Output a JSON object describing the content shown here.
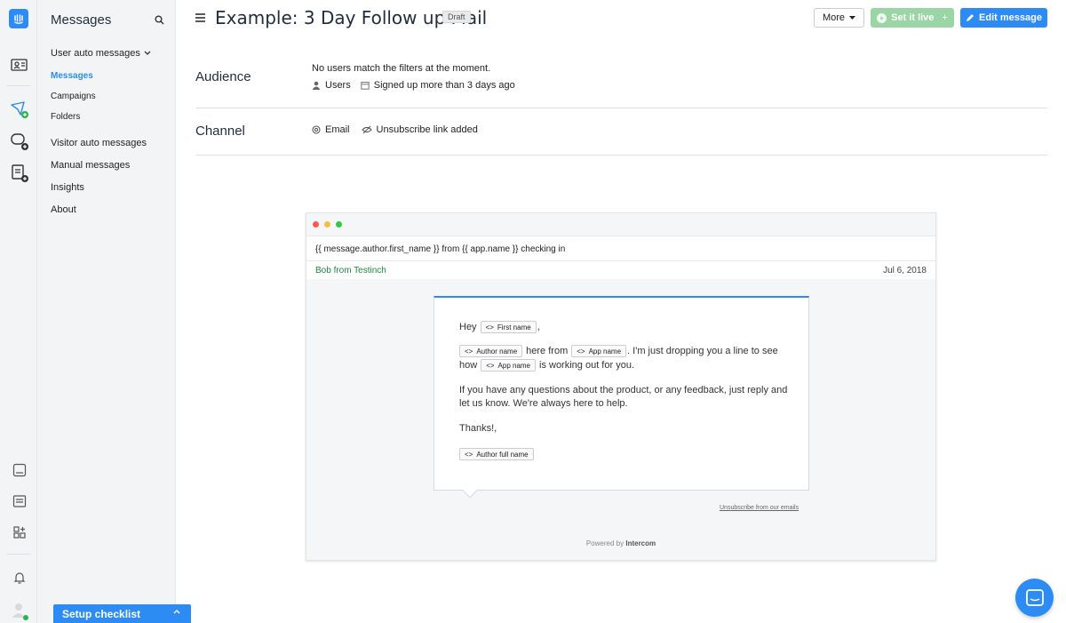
{
  "nav": {
    "title": "Messages",
    "group_label": "User auto messages",
    "items": [
      {
        "label": "Messages",
        "active": true
      },
      {
        "label": "Campaigns"
      },
      {
        "label": "Folders"
      },
      {
        "label": "Visitor auto messages"
      },
      {
        "label": "Manual messages"
      },
      {
        "label": "Insights"
      },
      {
        "label": "About"
      }
    ],
    "checklist_label": "Setup checklist"
  },
  "header": {
    "title": "Example: 3 Day Follow up Mail",
    "badge": "Draft",
    "more_label": "More",
    "set_live_label": "Set it live",
    "edit_label": "Edit message"
  },
  "audience": {
    "label": "Audience",
    "status": "No users match the filters at the moment.",
    "users_label": "Users",
    "filter": "Signed up more than 3 days ago"
  },
  "channel": {
    "label": "Channel",
    "type": "Email",
    "unsubscribe": "Unsubscribe link added"
  },
  "preview": {
    "subject": "{{ message.author.first_name }} from {{ app.name }} checking in",
    "from": "Bob from Testinch",
    "date": "Jul 6, 2018",
    "body": {
      "hey": "Hey",
      "first_name_chip": "First name",
      "comma": ",",
      "author_name_chip": "Author name",
      "here_from": "here from",
      "app_name_chip": "App name",
      "dropping": ". I'm just dropping you a line to see",
      "how": "how",
      "working_out": "is working out for you.",
      "para2_line1": "If you have any questions about the product, or any feedback, just reply and",
      "para2_line2": "let us know. We're always here to help.",
      "thanks": "Thanks!,",
      "author_full_chip": "Author full name"
    },
    "unsubscribe": "Unsubscribe from our emails",
    "powered_prefix": "Powered by",
    "powered_brand": "Intercom"
  },
  "colors": {
    "accent": "#2c8cf4",
    "live_button": "#9ad5a5",
    "from_green": "#1a8a3a"
  }
}
